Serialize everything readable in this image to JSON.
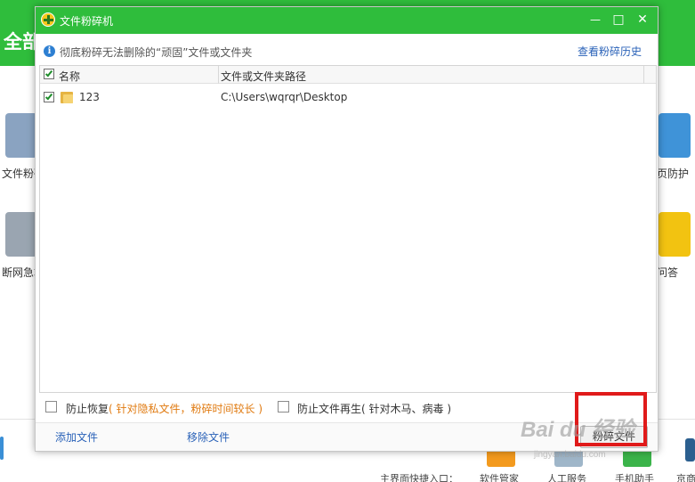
{
  "background": {
    "header_title": "全部",
    "tools_left": [
      {
        "label": "文件粉碎"
      },
      {
        "label": "断网急救"
      }
    ],
    "tools_right": [
      {
        "label": "页防护"
      },
      {
        "label": "问答"
      }
    ],
    "bottom": {
      "shortcut_label": "主界面快捷入口：",
      "items": [
        {
          "label": "软件管家"
        },
        {
          "label": "人工服务"
        },
        {
          "label": "手机助手"
        },
        {
          "label": "京商"
        }
      ]
    }
  },
  "dialog": {
    "title": "文件粉碎机",
    "window_controls": {
      "minimize": "—",
      "maximize": "□",
      "close": "✕"
    },
    "info_icon": "i",
    "info_text": "彻底粉碎无法删除的“顽固”文件或文件夹",
    "history_link": "查看粉碎历史",
    "table": {
      "headers": {
        "name": "名称",
        "path": "文件或文件夹路径"
      },
      "rows": [
        {
          "name": "123",
          "path": "C:\\Users\\wqrqr\\Desktop",
          "checked": true
        }
      ]
    },
    "options": {
      "prevent_recovery": "防止恢复",
      "prevent_recovery_hint": "( 针对隐私文件，粉碎时间较长 )",
      "prevent_regen": "防止文件再生",
      "prevent_regen_hint": "( 针对木马、病毒 )"
    },
    "actions": {
      "add_file": "添加文件",
      "remove_file": "移除文件",
      "shred_file": "粉碎文件"
    }
  },
  "watermark": {
    "text": "Bai du 经验",
    "sub": "jingyan.baidu.com"
  },
  "colors": {
    "brand_green": "#2fbd3c",
    "link_blue": "#2a62b8",
    "hint_orange": "#e07a10",
    "highlight_red": "#e01a1a"
  }
}
